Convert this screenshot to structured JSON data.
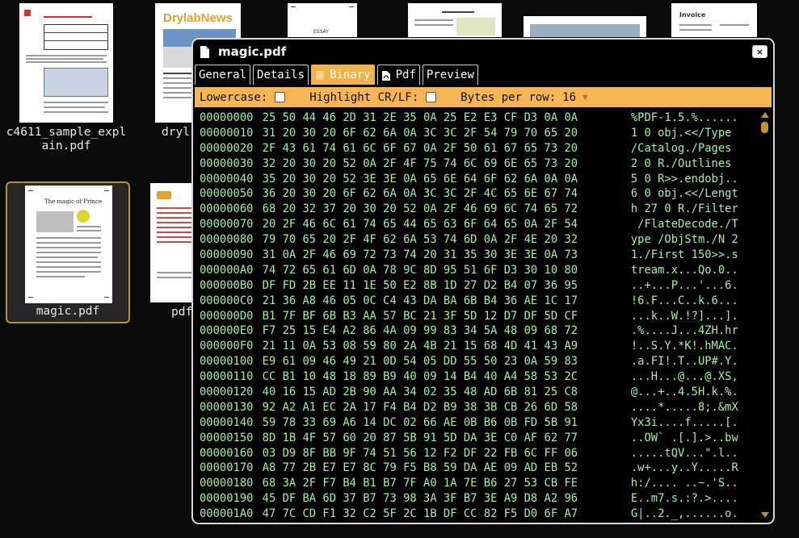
{
  "desktop": {
    "files": [
      {
        "name": "c4611_sample_expl\nain.pdf"
      },
      {
        "name": "dryl"
      },
      {
        "name": ""
      },
      {
        "name": ""
      },
      {
        "name": ""
      },
      {
        "name": ""
      },
      {
        "name": "magic.pdf",
        "selected": true
      },
      {
        "name": "pdf"
      }
    ],
    "thumb_texts": {
      "drylab_title": "DrylabNews",
      "magic_title": "The magic of Prince",
      "essay_label": "ESSAY",
      "invoice_label": "Invoice"
    }
  },
  "window": {
    "title": "magic.pdf",
    "close_label": "×",
    "tabs": [
      {
        "label": "General"
      },
      {
        "label": "Details"
      },
      {
        "label": "Binary",
        "active": true
      },
      {
        "label": "Pdf"
      },
      {
        "label": "Preview"
      }
    ],
    "options": {
      "lowercase_label": "Lowercase:",
      "lowercase_checked": false,
      "highlight_label": "Highlight CR/LF:",
      "highlight_checked": false,
      "bytes_per_row_label": "Bytes per row:",
      "bytes_per_row_value": "16"
    },
    "rows": [
      {
        "offset": "00000000",
        "hex": "25 50 44 46 2D 31 2E 35 0A 25 E2 E3 CF D3 0A 0A",
        "ascii": "%PDF-1.5.%......"
      },
      {
        "offset": "00000010",
        "hex": "31 20 30 20 6F 62 6A 0A 3C 3C 2F 54 79 70 65 20",
        "ascii": "1 0 obj.<</Type "
      },
      {
        "offset": "00000020",
        "hex": "2F 43 61 74 61 6C 6F 67 0A 2F 50 61 67 65 73 20",
        "ascii": "/Catalog./Pages "
      },
      {
        "offset": "00000030",
        "hex": "32 20 30 20 52 0A 2F 4F 75 74 6C 69 6E 65 73 20",
        "ascii": "2 0 R./Outlines "
      },
      {
        "offset": "00000040",
        "hex": "35 20 30 20 52 3E 3E 0A 65 6E 64 6F 62 6A 0A 0A",
        "ascii": "5 0 R>>.endobj.."
      },
      {
        "offset": "00000050",
        "hex": "36 20 30 20 6F 62 6A 0A 3C 3C 2F 4C 65 6E 67 74",
        "ascii": "6 0 obj.<</Lengt"
      },
      {
        "offset": "00000060",
        "hex": "68 20 32 37 20 30 20 52 0A 2F 46 69 6C 74 65 72",
        "ascii": "h 27 0 R./Filter"
      },
      {
        "offset": "00000070",
        "hex": "20 2F 46 6C 61 74 65 44 65 63 6F 64 65 0A 2F 54",
        "ascii": " /FlateDecode./T"
      },
      {
        "offset": "00000080",
        "hex": "79 70 65 20 2F 4F 62 6A 53 74 6D 0A 2F 4E 20 32",
        "ascii": "ype /ObjStm./N 2"
      },
      {
        "offset": "00000090",
        "hex": "31 0A 2F 46 69 72 73 74 20 31 35 30 3E 3E 0A 73",
        "ascii": "1./First 150>>.s"
      },
      {
        "offset": "000000A0",
        "hex": "74 72 65 61 6D 0A 78 9C 8D 95 51 6F D3 30 10 80",
        "ascii": "tream.x...Qo.0.."
      },
      {
        "offset": "000000B0",
        "hex": "DF FD 2B EE 11 1E 50 E2 8B 1D 27 D2 B4 07 36 95",
        "ascii": "..+...P...'...6."
      },
      {
        "offset": "000000C0",
        "hex": "21 36 A8 46 05 0C C4 43 DA BA 6B B4 36 AE 1C 17",
        "ascii": "!6.F...C..k.6..."
      },
      {
        "offset": "000000D0",
        "hex": "B1 7F BF 6B B3 AA 57 BC 21 3F 5D 12 D7 DF 5D CF",
        "ascii": "...k..W.!?]...]."
      },
      {
        "offset": "000000E0",
        "hex": "F7 25 15 E4 A2 86 4A 09 99 83 34 5A 48 09 68 72",
        "ascii": ".%....J...4ZH.hr"
      },
      {
        "offset": "000000F0",
        "hex": "21 11 0A 53 08 59 80 2A 4B 21 15 68 4D 41 43 A9",
        "ascii": "!..S.Y.*K!.hMAC."
      },
      {
        "offset": "00000100",
        "hex": "E9 61 09 46 49 21 0D 54 05 DD 55 50 23 0A 59 83",
        "ascii": ".a.FI!.T..UP#.Y."
      },
      {
        "offset": "00000110",
        "hex": "CC B1 10 48 18 89 B9 40 09 14 B4 40 A4 58 53 2C",
        "ascii": "...H...@...@.XS,"
      },
      {
        "offset": "00000120",
        "hex": "40 16 15 AD 2B 90 AA 34 02 35 48 AD 6B 81 25 C8",
        "ascii": "@...+..4.5H.k.%."
      },
      {
        "offset": "00000130",
        "hex": "92 A2 A1 EC 2A 17 F4 B4 D2 B9 38 3B CB 26 6D 58",
        "ascii": "....*.....8;.&mX"
      },
      {
        "offset": "00000140",
        "hex": "59 78 33 69 A6 14 DC 02 66 AE 0B B6 0B FD 5B 91",
        "ascii": "Yx3i....f.....[."
      },
      {
        "offset": "00000150",
        "hex": "8D 1B 4F 57 60 20 87 5B 91 5D DA 3E C0 AF 62 77",
        "ascii": "..OW` .[.].>..bw"
      },
      {
        "offset": "00000160",
        "hex": "03 D9 8F BB 9F 74 51 56 12 F2 DF 22 FB 6C FF 06",
        "ascii": ".....tQV...\".l.."
      },
      {
        "offset": "00000170",
        "hex": "A8 77 2B E7 E7 8C 79 F5 B8 59 DA AE 09 AD EB 52",
        "ascii": ".w+...y..Y.....R"
      },
      {
        "offset": "00000180",
        "hex": "68 3A 2F F7 B4 B1 B7 7F A0 1A 7E B6 27 53 CB FE",
        "ascii": "h:/.... ..~.'S.."
      },
      {
        "offset": "00000190",
        "hex": "45 DF BA 6D 37 B7 73 98 3A 3F B7 3E A9 D8 A2 96",
        "ascii": "E..m7.s.:?.>...."
      },
      {
        "offset": "000001A0",
        "hex": "47 7C CD F1 32 C2 5F 2C 1B DF CC 82 F5 D0 6F A7",
        "ascii": "G|..2._,......o."
      }
    ]
  }
}
